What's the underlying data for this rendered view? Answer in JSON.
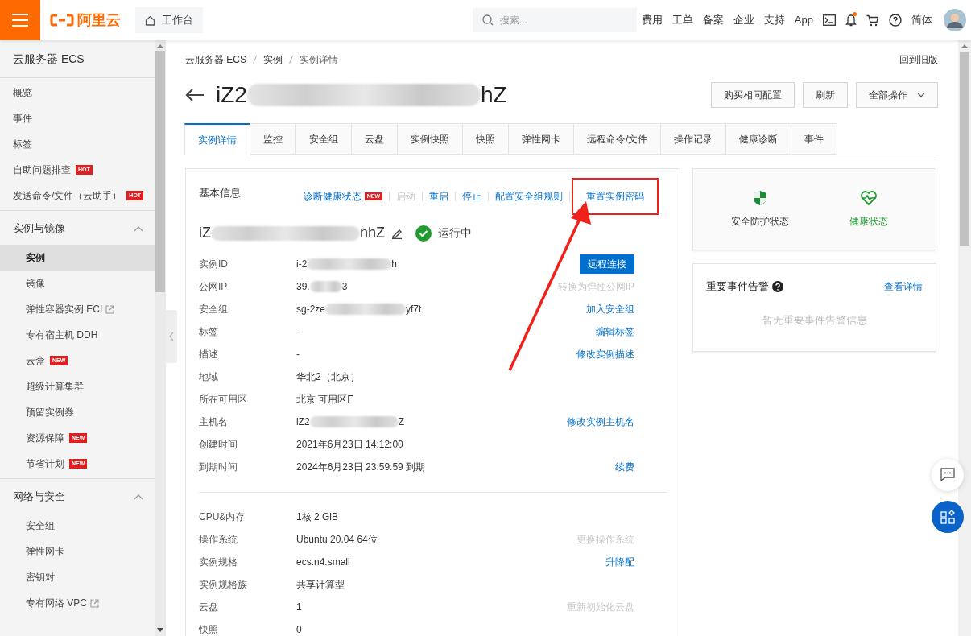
{
  "topbar": {
    "logo": "阿里云",
    "workbench": "工作台",
    "search": {
      "placeholder": "搜索..."
    },
    "links": [
      "费用",
      "工单",
      "备案",
      "企业",
      "支持",
      "App"
    ],
    "notification_dot": true,
    "language": "简体"
  },
  "sidebar": {
    "title": "云服务器 ECS",
    "sections": [
      {
        "items": [
          {
            "label": "概览",
            "selected": false
          },
          {
            "label": "事件",
            "selected": false
          },
          {
            "label": "标签",
            "selected": false
          },
          {
            "label": "自助问题排查",
            "badge": "HOT",
            "selected": false
          },
          {
            "label": "发送命令/文件（云助手）",
            "badge": "HOT",
            "selected": false
          }
        ]
      },
      {
        "label": "实例与镜像",
        "expanded": true,
        "items": [
          {
            "label": "实例",
            "selected": true
          },
          {
            "label": "镜像",
            "selected": false
          },
          {
            "label": "弹性容器实例 ECI",
            "external": true,
            "selected": false
          },
          {
            "label": "专有宿主机 DDH",
            "selected": false
          },
          {
            "label": "云盒",
            "badge": "NEW",
            "selected": false
          },
          {
            "label": "超级计算集群",
            "selected": false
          },
          {
            "label": "预留实例券",
            "selected": false
          },
          {
            "label": "资源保障",
            "badge": "NEW",
            "selected": false
          },
          {
            "label": "节省计划",
            "badge": "NEW",
            "selected": false
          }
        ]
      },
      {
        "label": "网络与安全",
        "expanded": true,
        "items": [
          {
            "label": "安全组",
            "selected": false
          },
          {
            "label": "弹性网卡",
            "selected": false
          },
          {
            "label": "密钥对",
            "selected": false
          },
          {
            "label": "专有网络 VPC",
            "external": true,
            "selected": false
          }
        ]
      }
    ]
  },
  "breadcrumb": [
    "云服务器 ECS",
    "实例",
    "实例详情"
  ],
  "back_to_old": "回到旧版",
  "title": {
    "start": "iZ2",
    "end": "hZ",
    "redacted": true
  },
  "header_buttons": [
    {
      "label": "购买相同配置",
      "dropdown": false
    },
    {
      "label": "刷新",
      "dropdown": false
    },
    {
      "label": "全部操作",
      "dropdown": true
    }
  ],
  "tabs": [
    {
      "label": "实例详情",
      "selected": true
    },
    {
      "label": "监控",
      "selected": false
    },
    {
      "label": "安全组",
      "selected": false
    },
    {
      "label": "云盘",
      "selected": false
    },
    {
      "label": "实例快照",
      "selected": false
    },
    {
      "label": "快照",
      "selected": false
    },
    {
      "label": "弹性网卡",
      "selected": false
    },
    {
      "label": "远程命令/文件",
      "selected": false
    },
    {
      "label": "操作记录",
      "selected": false
    },
    {
      "label": "健康诊断",
      "selected": false
    },
    {
      "label": "事件",
      "selected": false
    }
  ],
  "basic_info": {
    "title": "基本信息",
    "actions": [
      {
        "label": "诊断健康状态",
        "badge": "NEW",
        "disabled": false,
        "highlighted": false
      },
      {
        "label": "启动",
        "disabled": true,
        "highlighted": false
      },
      {
        "label": "重启",
        "disabled": false,
        "highlighted": false
      },
      {
        "label": "停止",
        "disabled": false,
        "highlighted": false
      },
      {
        "label": "配置安全组规则",
        "disabled": false,
        "highlighted": false
      },
      {
        "label": "重置实例密码",
        "disabled": false,
        "highlighted": true
      }
    ],
    "name": {
      "start": "iZ",
      "end": "nhZ",
      "redacted": true
    },
    "status": {
      "label": "运行中",
      "kind": "running"
    },
    "rows": [
      {
        "label": "实例ID",
        "value": "i-2",
        "value_end": "h",
        "redacted": true,
        "action": {
          "label": "远程连接",
          "kind": "button"
        }
      },
      {
        "label": "公网IP",
        "value": "39.",
        "value_end": "3",
        "redacted": true,
        "action": {
          "label": "转换为弹性公网IP",
          "kind": "link",
          "disabled": true
        }
      },
      {
        "label": "安全组",
        "value": "sg-2ze",
        "value_end": "yf7t",
        "redacted": true,
        "action": {
          "label": "加入安全组",
          "kind": "link",
          "disabled": false
        }
      },
      {
        "label": "标签",
        "value": "-",
        "redacted": false,
        "action": {
          "label": "编辑标签",
          "kind": "link",
          "disabled": false
        }
      },
      {
        "label": "描述",
        "value": "-",
        "redacted": false,
        "action": {
          "label": "修改实例描述",
          "kind": "link",
          "disabled": false
        }
      },
      {
        "label": "地域",
        "value": "华北2（北京）",
        "redacted": false
      },
      {
        "label": "所在可用区",
        "value": "北京 可用区F",
        "redacted": false
      },
      {
        "label": "主机名",
        "value": "iZ2",
        "value_end": "Z",
        "redacted": true,
        "action": {
          "label": "修改实例主机名",
          "kind": "link",
          "disabled": false
        }
      },
      {
        "label": "创建时间",
        "value": "2021年6月23日 14:12:00",
        "redacted": false
      },
      {
        "label": "到期时间",
        "value": "2024年6月23日 23:59:59 到期",
        "redacted": false,
        "action": {
          "label": "续费",
          "kind": "link",
          "disabled": false
        }
      }
    ],
    "config_rows": [
      {
        "label": "CPU&内存",
        "value": "1核 2 GiB",
        "redacted": false
      },
      {
        "label": "操作系统",
        "value": "Ubuntu 20.04 64位",
        "redacted": false,
        "action": {
          "label": "更换操作系统",
          "kind": "link",
          "disabled": true
        }
      },
      {
        "label": "实例规格",
        "value": "ecs.n4.small",
        "redacted": false,
        "action": {
          "label": "升降配",
          "kind": "link",
          "disabled": false
        }
      },
      {
        "label": "实例规格族",
        "value": "共享计算型",
        "redacted": false
      },
      {
        "label": "云盘",
        "value": "1",
        "redacted": false,
        "action": {
          "label": "重新初始化云盘",
          "kind": "link",
          "disabled": true
        }
      },
      {
        "label": "快照",
        "value": "0",
        "redacted": false
      }
    ]
  },
  "status_card": [
    {
      "label": "安全防护状态",
      "kind": "shield"
    },
    {
      "label": "健康状态",
      "kind": "heart"
    }
  ],
  "events_card": {
    "title": "重要事件告警",
    "link": "查看详情",
    "empty": "暂无重要事件告警信息"
  }
}
